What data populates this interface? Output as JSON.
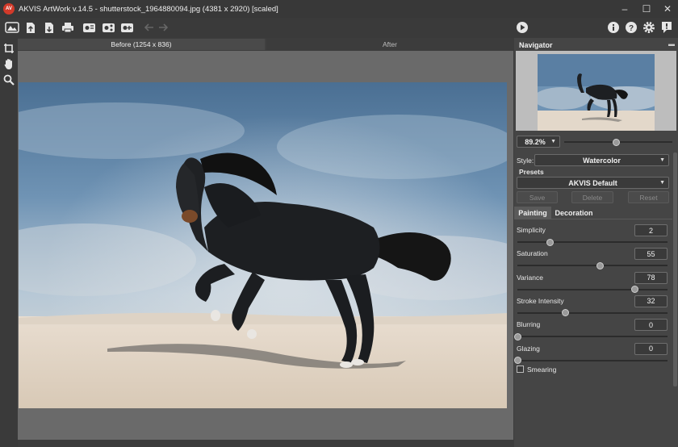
{
  "window": {
    "title": "AKVIS ArtWork v.14.5 - shutterstock_1964880094.jpg (4381 x 2920) [scaled]",
    "logo_text": "AV",
    "controls": [
      "–",
      "☐",
      "✕"
    ]
  },
  "toolbar": {
    "icons": [
      "home-icon",
      "open-file-icon",
      "save-file-icon",
      "print-icon",
      "batch-icon",
      "share-icon",
      "plugin-icon",
      "undo-icon",
      "redo-icon"
    ],
    "right_icons": [
      "run-icon",
      "info-icon",
      "help-icon",
      "settings-icon",
      "news-icon"
    ]
  },
  "left_tools": [
    "crop-tool-icon",
    "hand-tool-icon",
    "zoom-tool-icon"
  ],
  "canvas": {
    "tab_before": "Before (1254 x 836)",
    "tab_after": "After"
  },
  "navigator": {
    "title": "Navigator",
    "zoom": "89.2%",
    "zoom_slider_fraction": 0.48
  },
  "settings": {
    "style_label": "Style:",
    "style_value": "Watercolor",
    "presets_label": "Presets",
    "preset_value": "AKVIS Default",
    "buttons": {
      "save": "Save",
      "delete": "Delete",
      "reset": "Reset"
    },
    "tabs": {
      "painting": "Painting",
      "decoration": "Decoration"
    },
    "params": [
      {
        "label": "Simplicity",
        "value": "2",
        "fraction": 0.22
      },
      {
        "label": "Saturation",
        "value": "55",
        "fraction": 0.55
      },
      {
        "label": "Variance",
        "value": "78",
        "fraction": 0.78
      },
      {
        "label": "Stroke Intensity",
        "value": "32",
        "fraction": 0.32
      },
      {
        "label": "Blurring",
        "value": "0",
        "fraction": 0.0
      },
      {
        "label": "Glazing",
        "value": "0",
        "fraction": 0.0
      }
    ],
    "smearing_label": "Smearing",
    "smearing_checked": false
  },
  "colors": {
    "app_bg": "#3c3c3c",
    "panel_bg": "#454545",
    "logo_red": "#d23a2a"
  }
}
